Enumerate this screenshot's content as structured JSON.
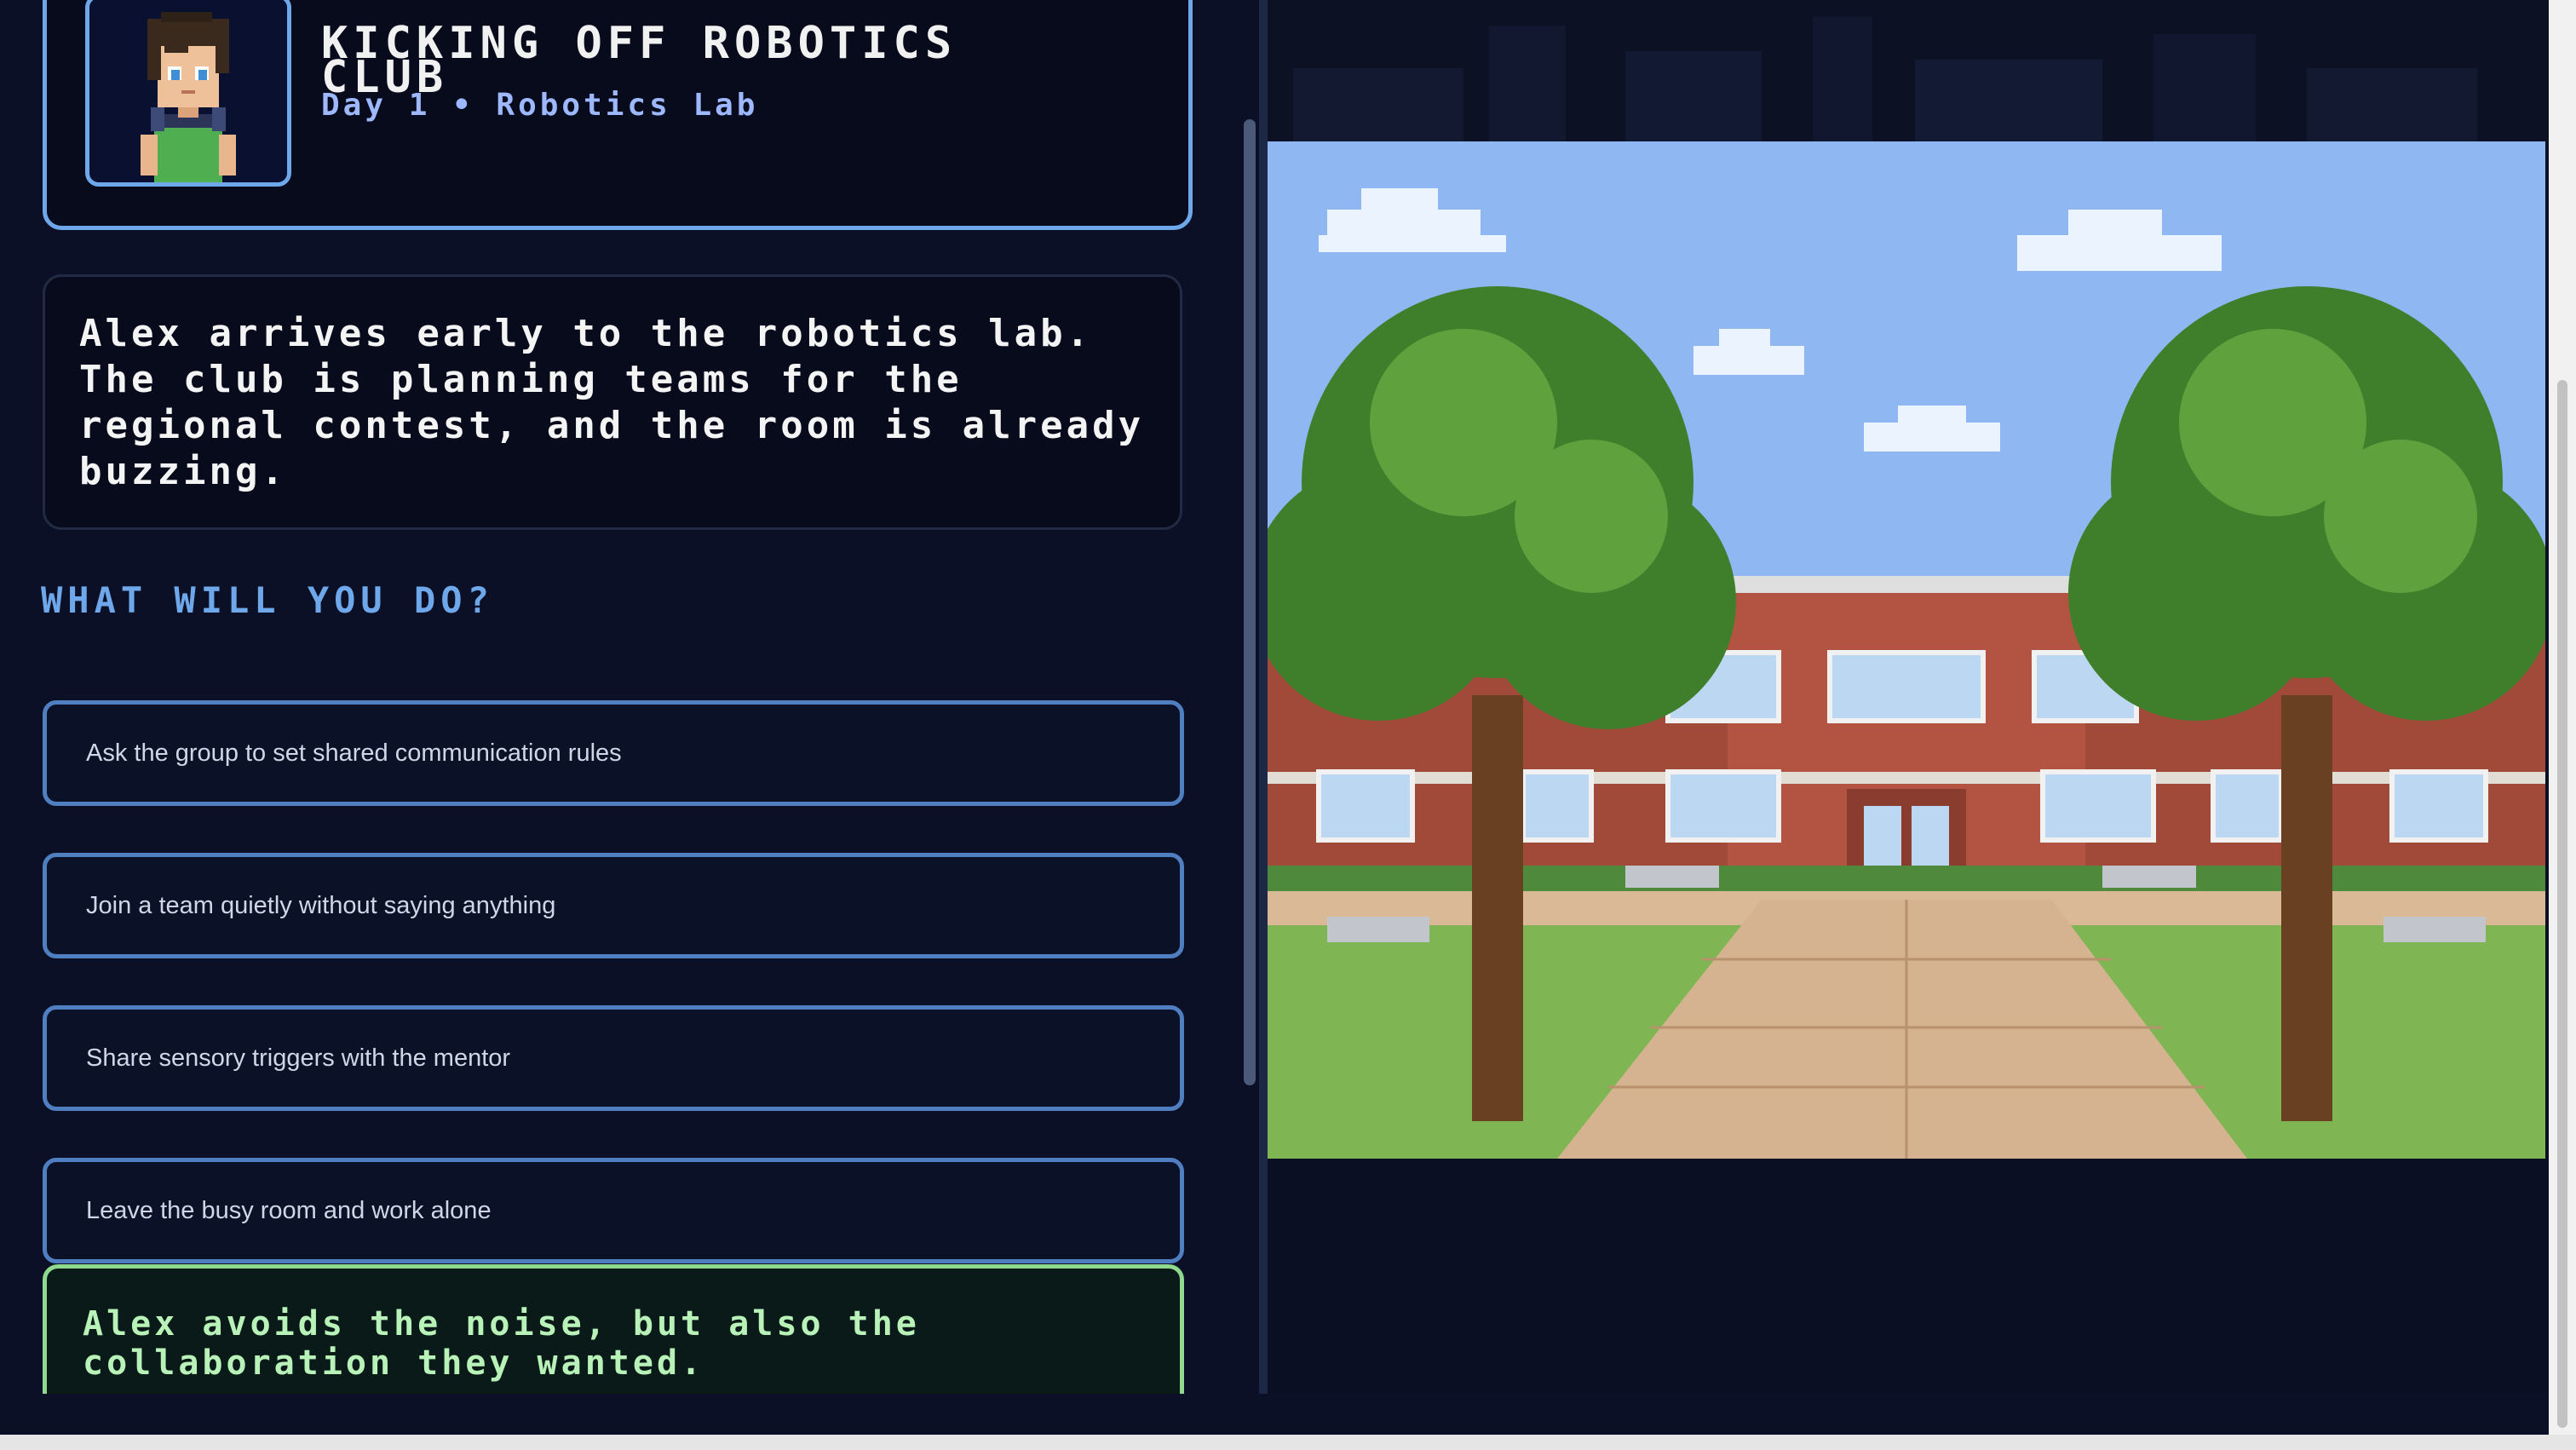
{
  "chapter": {
    "title": "KICKING OFF ROBOTICS CLUB",
    "subtitle": "Day 1 • Robotics Lab"
  },
  "story": {
    "text": "Alex arrives early to the robotics lab. The club is planning teams for the regional contest, and the room is already buzzing."
  },
  "prompt": {
    "heading": "WHAT WILL YOU DO?"
  },
  "choices": [
    {
      "label": "Ask the group to set shared communication rules"
    },
    {
      "label": "Join a team quietly without saying anything"
    },
    {
      "label": "Share sensory triggers with the mentor"
    },
    {
      "label": "Leave the busy room and work alone"
    }
  ],
  "outcome": {
    "text": "Alex avoids the noise, but also the collaboration they wanted."
  },
  "colors": {
    "background": "#0b1026",
    "accent_blue": "#6fa8ea",
    "choice_border": "#4f7fc0",
    "subtitle": "#9eb8ff",
    "outcome_green": "#8fd98f"
  },
  "icons": {
    "portrait": "student-avatar-icon",
    "scene": "school-courtyard-scene"
  }
}
